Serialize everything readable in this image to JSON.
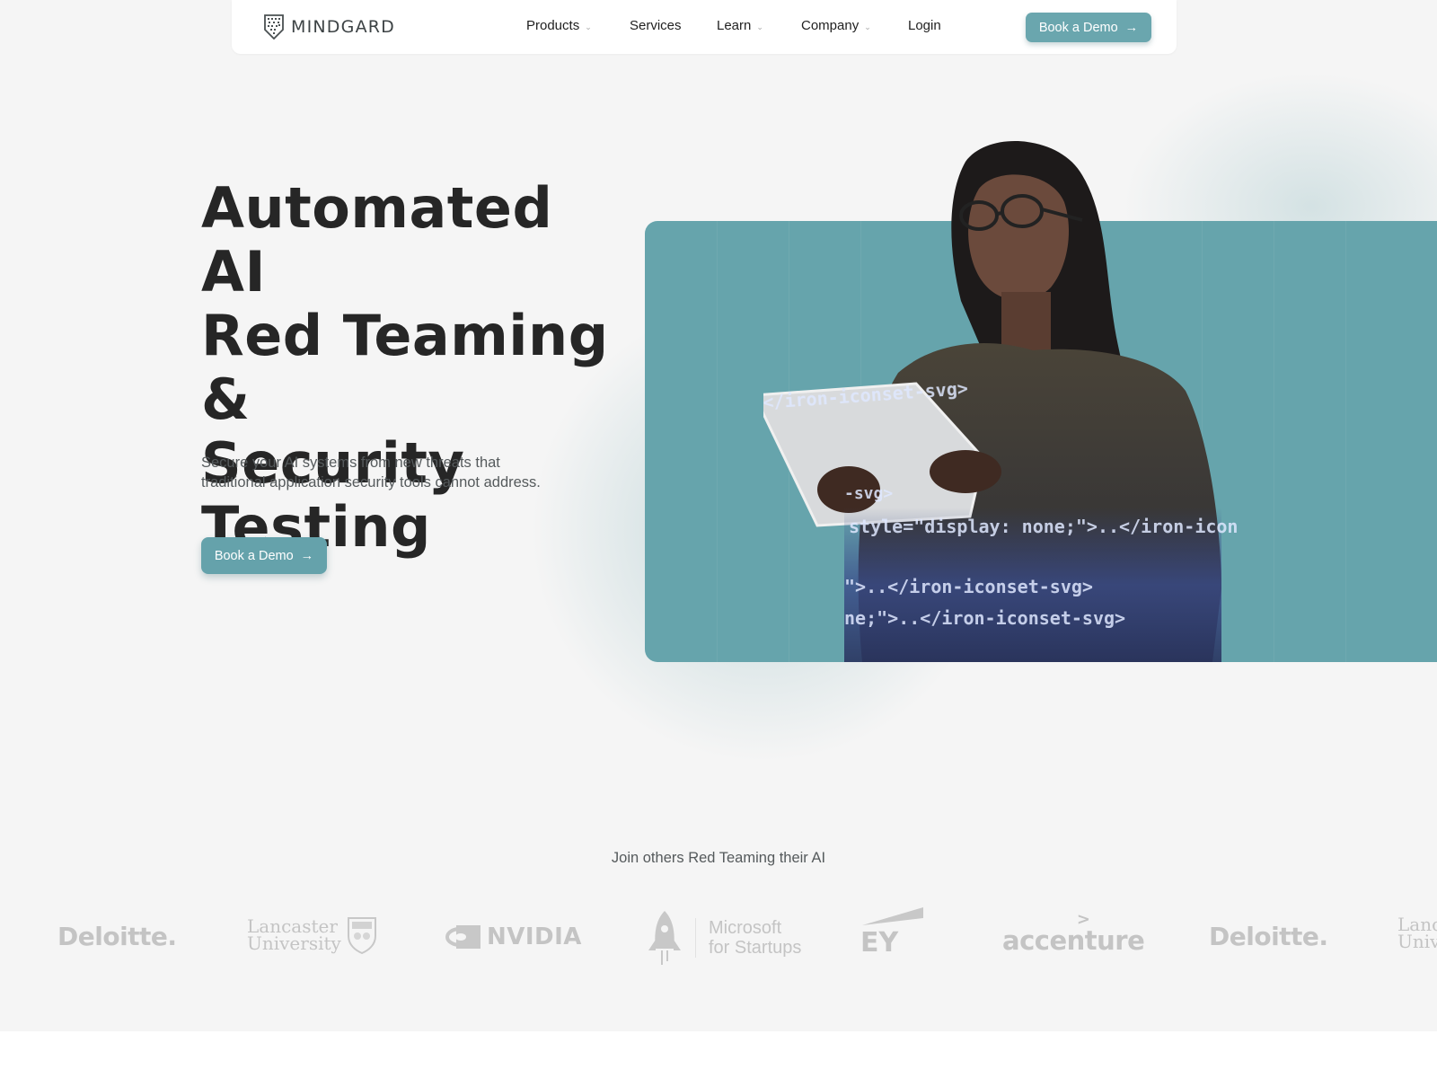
{
  "nav": {
    "brand": "MINDGARD",
    "items": [
      {
        "label": "Products",
        "has_dropdown": true
      },
      {
        "label": "Services",
        "has_dropdown": false
      },
      {
        "label": "Learn",
        "has_dropdown": true
      },
      {
        "label": "Company",
        "has_dropdown": true
      },
      {
        "label": "Login",
        "has_dropdown": false
      }
    ],
    "cta_label": "Book a Demo",
    "cta_icon": "arrow-right-icon"
  },
  "hero": {
    "title_lines": [
      "Automated AI",
      "Red Teaming &",
      "Security",
      "Testing"
    ],
    "subtitle_line1": "Secure your AI systems from new threats that",
    "subtitle_line2": "traditional application security tools cannot address.",
    "cta_label": "Book a Demo",
    "cta_icon": "arrow-right-icon",
    "image_alt": "Woman with glasses holding a tablet, overlaid with code",
    "code_overlay": [
      "</iron-iconset-svg>",
      "-svg>",
      "style=\"display: none;\">..</iron-icon",
      "\">..</iron-iconset-svg>",
      "ne;\">..</iron-iconset-svg>"
    ]
  },
  "clients": {
    "label": "Join others Red Teaming their AI",
    "logos": [
      {
        "name": "Deloitte",
        "text": "Deloitte."
      },
      {
        "name": "Lancaster University",
        "line1": "Lancaster",
        "line2": "University"
      },
      {
        "name": "NVIDIA",
        "text": "NVIDIA"
      },
      {
        "name": "Microsoft for Startups",
        "line1": "Microsoft",
        "line2": "for Startups"
      },
      {
        "name": "EY",
        "text": "EY"
      },
      {
        "name": "Accenture",
        "text": "accenture"
      },
      {
        "name": "Deloitte",
        "text": "Deloitte."
      },
      {
        "name": "Lancaster University",
        "line1": "Lanc",
        "line2": "Univ"
      }
    ]
  },
  "colors": {
    "accent": "#66a4ac",
    "heading": "#262626",
    "body_text": "#555a5c",
    "background": "#f5f5f5",
    "logo_gray": "#c4c4c4"
  }
}
